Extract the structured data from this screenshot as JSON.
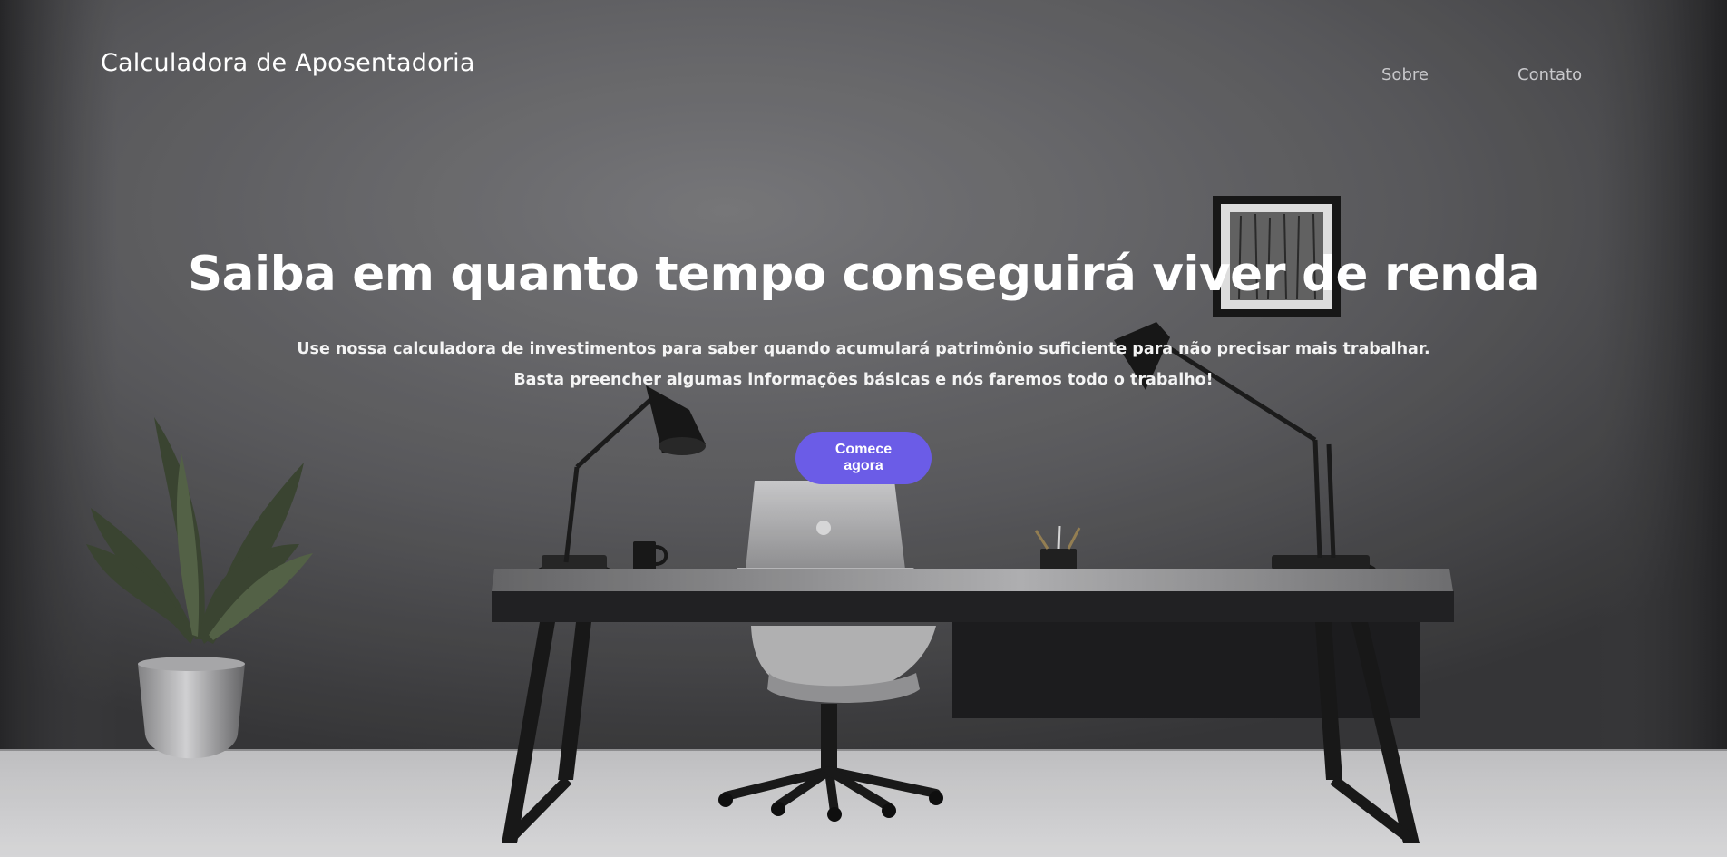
{
  "header": {
    "logo_text": "Calculadora de Aposentadoria",
    "nav": [
      {
        "label": "Sobre"
      },
      {
        "label": "Contato"
      }
    ]
  },
  "hero": {
    "headline": "Saiba em quanto tempo conseguirá viver de renda",
    "subtitle": "Use nossa calculadora de investimentos para saber quando acumulará patrimônio suficiente para não precisar mais trabalhar. Basta preencher algumas informações básicas e nós faremos todo o trabalho!",
    "cta_label": "Comece agora",
    "background": "office-desk-photo",
    "colors": {
      "accent": "#6b5ce7",
      "text": "#ffffff",
      "nav_text": "#c9c9cc"
    }
  }
}
